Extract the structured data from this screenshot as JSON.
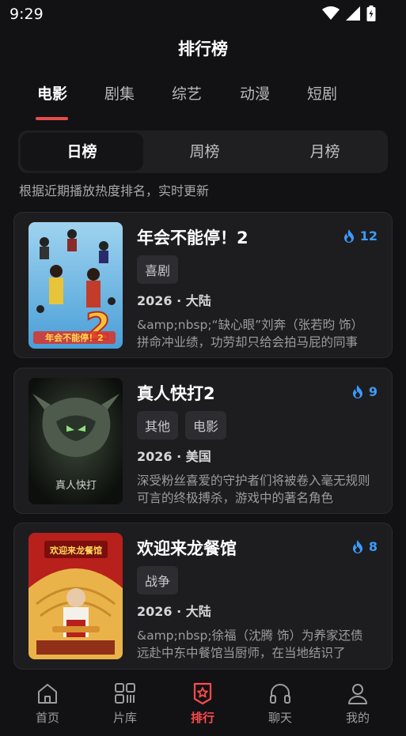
{
  "status": {
    "time": "9:29"
  },
  "header": {
    "title": "排行榜"
  },
  "category_tabs": [
    {
      "label": "电影",
      "active": true
    },
    {
      "label": "剧集",
      "active": false
    },
    {
      "label": "综艺",
      "active": false
    },
    {
      "label": "动漫",
      "active": false
    },
    {
      "label": "短剧",
      "active": false
    }
  ],
  "period_tabs": [
    {
      "label": "日榜",
      "active": true
    },
    {
      "label": "周榜",
      "active": false
    },
    {
      "label": "月榜",
      "active": false
    }
  ],
  "hint": "根据近期播放热度排名，实时更新",
  "colors": {
    "accent": "#e84c4c",
    "heat": "#3d9bff",
    "background": "#121215",
    "card": "#1d1d20"
  },
  "rankings": [
    {
      "title": "年会不能停！2",
      "heat": "12",
      "tags": [
        "喜剧"
      ],
      "meta": "2026 · 大陆",
      "desc": "&amp;nbsp;“缺心眼”刘奔（张若昀 饰）拼命冲业绩，功劳却只给会拍马屁的同事",
      "poster_text": "年会不能停！2"
    },
    {
      "title": "真人快打2",
      "heat": "9",
      "tags": [
        "其他",
        "电影"
      ],
      "meta": "2026 · 美国",
      "desc": "深受粉丝喜爱的守护者们将被卷入毫无规则可言的终极搏杀，游戏中的著名角色",
      "poster_text": "真人快打"
    },
    {
      "title": "欢迎来龙餐馆",
      "heat": "8",
      "tags": [
        "战争"
      ],
      "meta": "2026 · 大陆",
      "desc": "&amp;nbsp;徐福（沈腾 饰）为养家还债远赴中东中餐馆当厨师，在当地结识了",
      "poster_text": "欢迎来龙餐馆"
    }
  ],
  "bottom_nav": [
    {
      "label": "首页",
      "icon": "home-icon",
      "active": false
    },
    {
      "label": "片库",
      "icon": "library-icon",
      "active": false
    },
    {
      "label": "排行",
      "icon": "ranking-badge-icon",
      "active": true
    },
    {
      "label": "聊天",
      "icon": "headphones-icon",
      "active": false
    },
    {
      "label": "我的",
      "icon": "user-icon",
      "active": false
    }
  ]
}
